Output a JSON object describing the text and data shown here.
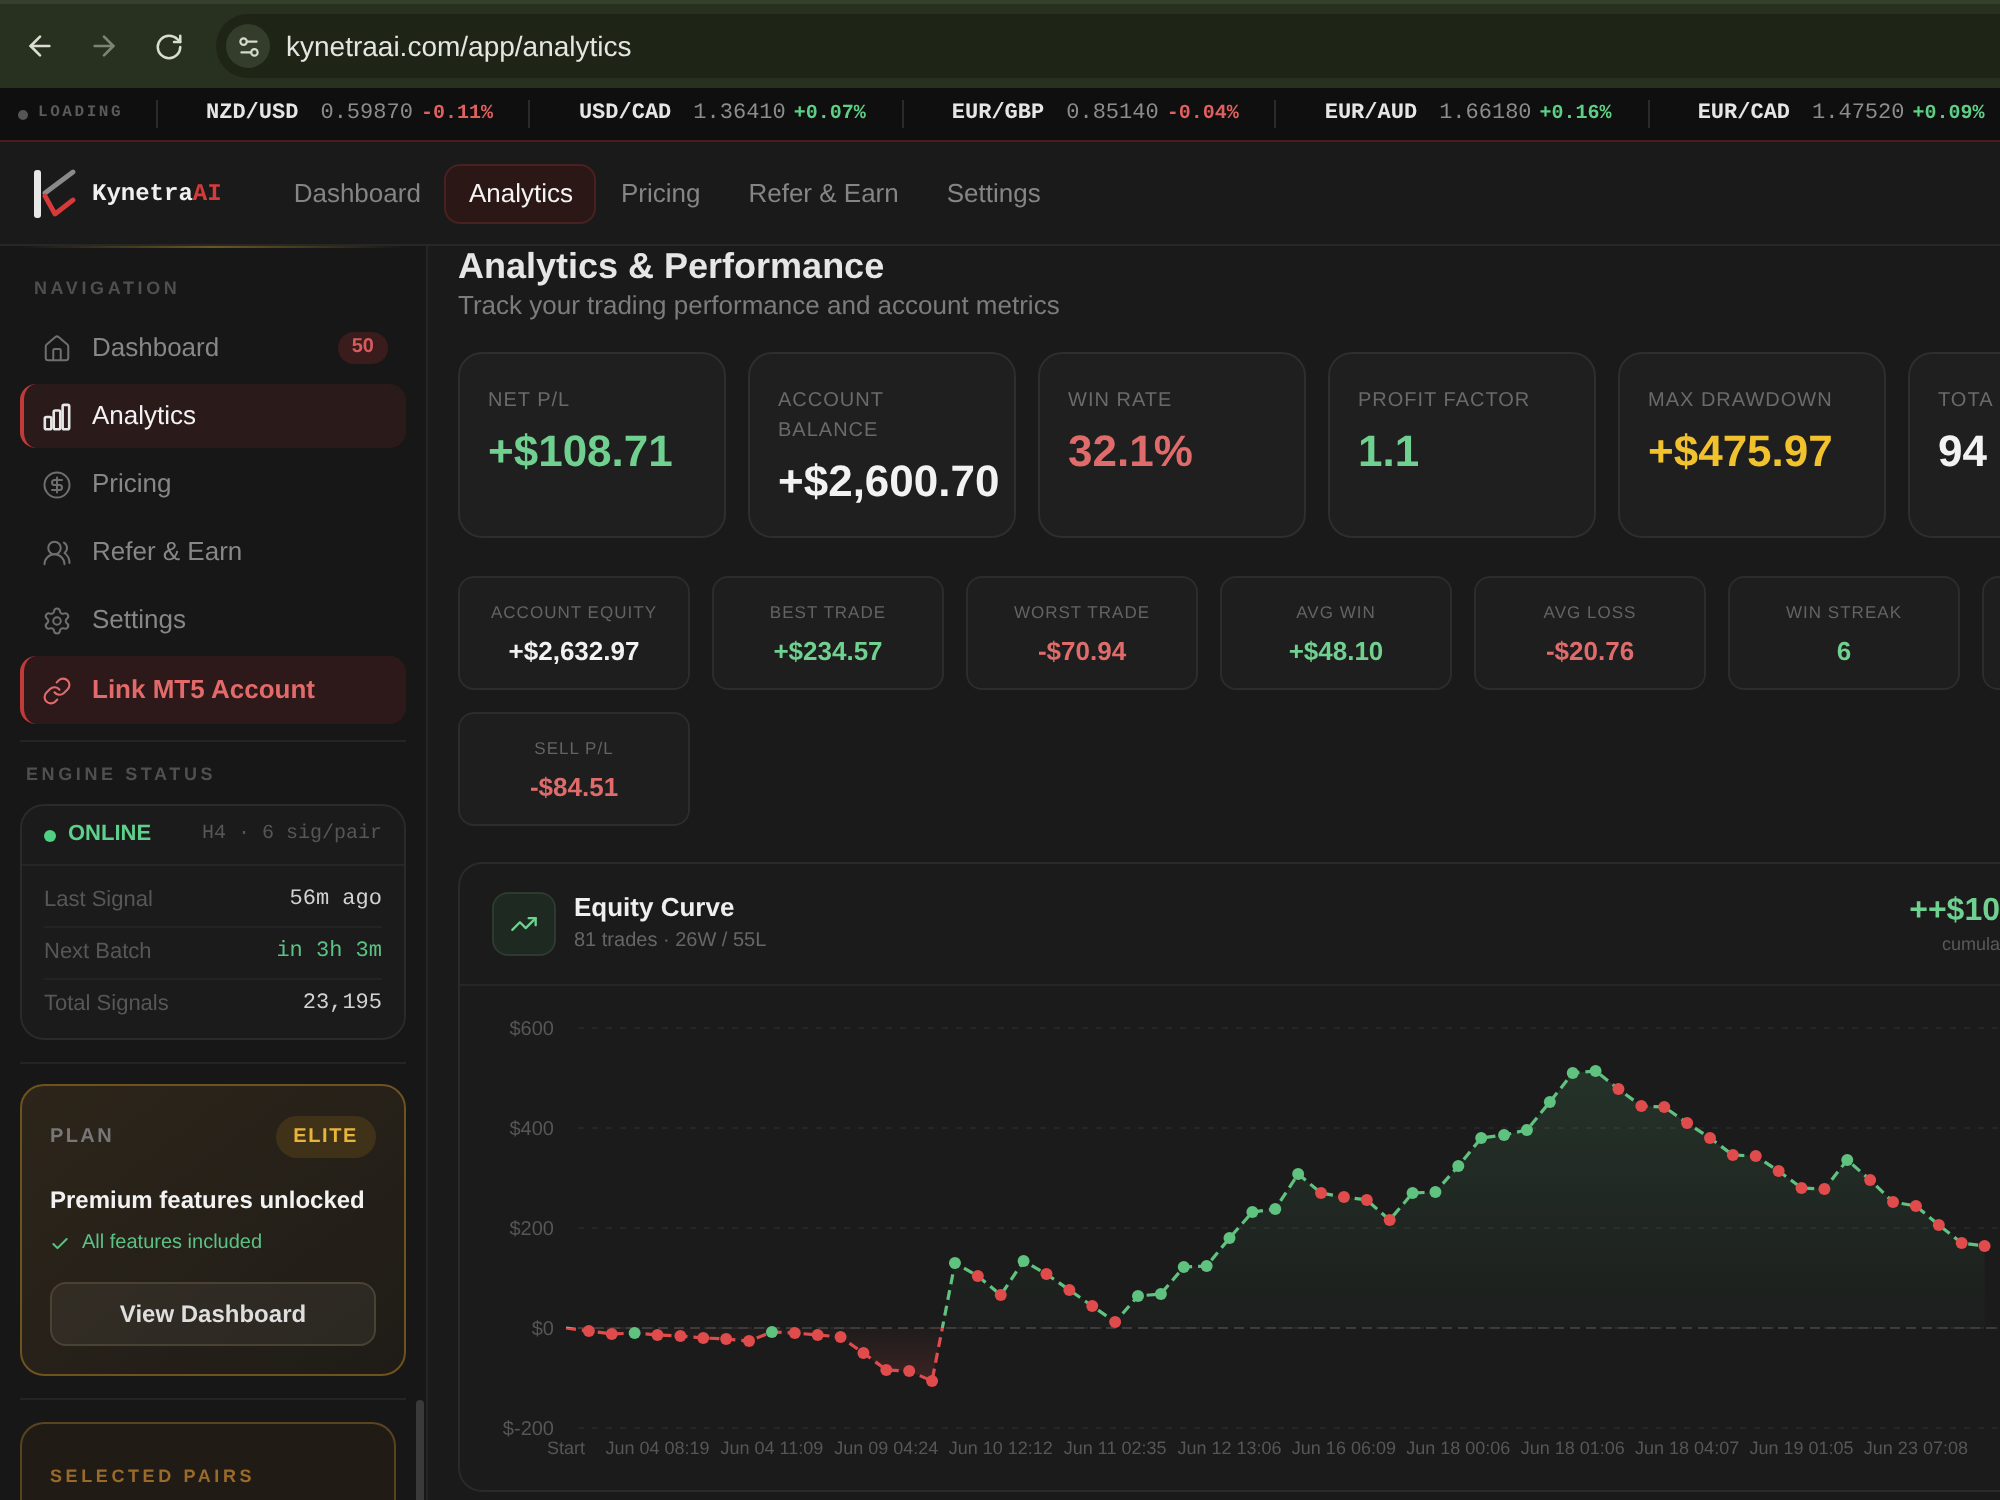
{
  "browser": {
    "url": "kynetraai.com/app/analytics"
  },
  "ticker": {
    "status": "LOADING",
    "quotes": [
      {
        "pair": "NZD/USD",
        "price": "0.59870",
        "change": "-0.11%",
        "color": "#e0605f"
      },
      {
        "pair": "USD/CAD",
        "price": "1.36410",
        "change": "+0.07%",
        "color": "#5fcf85"
      },
      {
        "pair": "EUR/GBP",
        "price": "0.85140",
        "change": "-0.04%",
        "color": "#e0605f"
      },
      {
        "pair": "EUR/AUD",
        "price": "1.66180",
        "change": "+0.16%",
        "color": "#5fcf85"
      },
      {
        "pair": "EUR/CAD",
        "price": "1.47520",
        "change": "+0.09%",
        "color": "#5fcf85"
      }
    ]
  },
  "header": {
    "brand": {
      "name": "Kynetra",
      "accent": "AI"
    },
    "tabs": [
      {
        "label": "Dashboard",
        "selected": false
      },
      {
        "label": "Analytics",
        "selected": true
      },
      {
        "label": "Pricing",
        "selected": false
      },
      {
        "label": "Refer & Earn",
        "selected": false
      },
      {
        "label": "Settings",
        "selected": false
      }
    ]
  },
  "sidebar": {
    "nav_title": "NAVIGATION",
    "items": [
      {
        "label": "Dashboard",
        "selected": false,
        "badge": "50"
      },
      {
        "label": "Analytics",
        "selected": true
      },
      {
        "label": "Pricing",
        "selected": false
      },
      {
        "label": "Refer & Earn",
        "selected": false
      },
      {
        "label": "Settings",
        "selected": false
      }
    ],
    "link_account": {
      "label": "Link MT5 Account"
    },
    "engine": {
      "title": "ENGINE STATUS",
      "status": "ONLINE",
      "online": true,
      "meta": "H4 · 6 sig/pair",
      "rows": [
        {
          "label": "Last Signal",
          "value": "56m ago",
          "highlight": false
        },
        {
          "label": "Next Batch",
          "value": "in 3h 3m",
          "highlight": true
        },
        {
          "label": "Total Signals",
          "value": "23,195",
          "highlight": false
        }
      ]
    },
    "plan": {
      "label": "PLAN",
      "tier": "ELITE",
      "headline": "Premium features unlocked",
      "feature": "All features included",
      "button": "View Dashboard"
    },
    "pairs": {
      "title": "SELECTED PAIRS"
    }
  },
  "page": {
    "title": "Analytics & Performance",
    "subtitle": "Track your trading performance and account metrics"
  },
  "metrics": [
    {
      "label": "NET P/L",
      "value": "+$108.71",
      "color": "#6fd08f"
    },
    {
      "label": "ACCOUNT BALANCE",
      "value": "+$2,600.70",
      "color": "#f2f2f2"
    },
    {
      "label": "WIN RATE",
      "value": "32.1%",
      "color": "#e06b6b"
    },
    {
      "label": "PROFIT FACTOR",
      "value": "1.1",
      "color": "#6fd08f"
    },
    {
      "label": "MAX DRAWDOWN",
      "value": "+$475.97",
      "color": "#f2c12e"
    },
    {
      "label": "TOTA",
      "value": "94",
      "color": "#f2f2f2"
    }
  ],
  "details": [
    {
      "label": "ACCOUNT EQUITY",
      "value": "+$2,632.97",
      "color": "#f2f2f2"
    },
    {
      "label": "BEST TRADE",
      "value": "+$234.57",
      "color": "#6fd08f"
    },
    {
      "label": "WORST TRADE",
      "value": "-$70.94",
      "color": "#e06b6b"
    },
    {
      "label": "AVG WIN",
      "value": "+$48.10",
      "color": "#6fd08f"
    },
    {
      "label": "AVG LOSS",
      "value": "-$20.76",
      "color": "#e06b6b"
    },
    {
      "label": "WIN STREAK",
      "value": "6",
      "color": "#6fd08f"
    },
    {
      "label": "SELL P/L",
      "value": "-$84.51",
      "color": "#e06b6b"
    }
  ],
  "equity_curve": {
    "title": "Equity Curve",
    "summary": "81 trades · 26W / 55L",
    "total": "++$10",
    "total_caption": "cumula",
    "chart_data": {
      "type": "line",
      "categories": [
        "Start",
        null,
        null,
        null,
        "Jun 04 08:19",
        null,
        null,
        null,
        null,
        "Jun 04 11:09",
        null,
        null,
        null,
        null,
        "Jun 09 04:24",
        null,
        null,
        null,
        null,
        "Jun 10 12:12",
        null,
        null,
        null,
        null,
        "Jun 11 02:35",
        null,
        null,
        null,
        null,
        "Jun 12 13:06",
        null,
        null,
        null,
        null,
        "Jun 16 06:09",
        null,
        null,
        null,
        null,
        "Jun 18 00:06",
        null,
        null,
        null,
        null,
        "Jun 18 01:06",
        null,
        null,
        null,
        null,
        "Jun 18 04:07",
        null,
        null,
        null,
        null,
        "Jun 19 01:05",
        null,
        null,
        null,
        null,
        "Jun 23 07:08",
        null,
        null,
        null
      ],
      "ylim": [
        -200,
        600
      ],
      "yticks": [
        {
          "value": 600,
          "label": "$600"
        },
        {
          "value": 400,
          "label": "$400"
        },
        {
          "value": 200,
          "label": "$200"
        },
        {
          "value": 0,
          "label": "$0"
        },
        {
          "value": -200,
          "label": "$-200"
        }
      ],
      "grid": true,
      "ref_lines": [
        {
          "axis": "y",
          "value": 0,
          "line_style": "dashed"
        }
      ],
      "series": [
        {
          "color": "#5fc27e",
          "line_style": "dashed",
          "marker": "circle",
          "values": [
            0,
            -6,
            -12,
            -10,
            -14,
            -16,
            -20,
            -22,
            -26,
            -8,
            -10,
            -14,
            -18,
            -50,
            -84,
            -86,
            -106,
            130,
            104,
            66,
            134,
            108,
            76,
            44,
            12,
            64,
            68,
            122,
            124,
            180,
            232,
            238,
            308,
            270,
            262,
            256,
            216,
            270,
            272,
            324,
            380,
            386,
            396,
            452,
            510,
            514,
            478,
            444,
            442,
            410,
            380,
            346,
            344,
            314,
            280,
            278,
            336,
            296,
            252,
            244,
            206,
            170,
            164
          ]
        }
      ]
    }
  }
}
